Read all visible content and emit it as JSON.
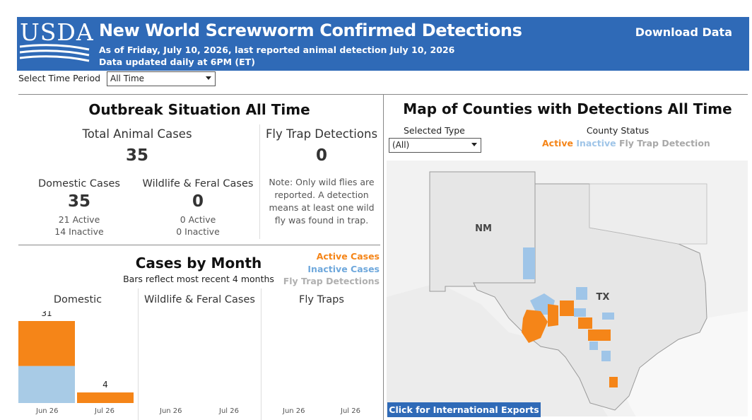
{
  "header": {
    "logo_text": "USDA",
    "title": "New World Screwworm Confirmed Detections",
    "subtitle1": "As of Friday, July 10, 2026, last reported animal detection July 10, 2026",
    "subtitle2": "Data updated daily at 6PM (ET)",
    "download": "Download Data",
    "bg_color": "#2f6ab7"
  },
  "filters": {
    "time_period_label": "Select Time Period",
    "time_period_value": "All Time"
  },
  "outbreak": {
    "title": "Outbreak Situation All Time",
    "total_label": "Total Animal Cases",
    "total_value": "35",
    "domestic_label": "Domestic Cases",
    "domestic_value": "35",
    "domestic_active": "21 Active",
    "domestic_inactive": "14 Inactive",
    "wildlife_label": "Wildlife & Feral Cases",
    "wildlife_value": "0",
    "wildlife_active": "0 Active",
    "wildlife_inactive": "0 Inactive",
    "flytrap_label": "Fly Trap Detections",
    "flytrap_value": "0",
    "flytrap_note": "Note: Only wild flies are reported. A detection means at least one wild fly was found in trap."
  },
  "cases_by_month": {
    "title": "Cases by Month",
    "subtitle": "Bars reflect most recent 4 months",
    "legend": [
      {
        "label": "Active Cases",
        "color": "#f58518"
      },
      {
        "label": "Inactive Cases",
        "color": "#6fa8dc"
      },
      {
        "label": "Fly Trap Detections",
        "color": "#b0b0b0"
      }
    ],
    "panels": {
      "domestic": "Domestic",
      "wildlife": "Wildlife & Feral Cases",
      "flytraps": "Fly Traps"
    }
  },
  "chart_data": {
    "type": "bar",
    "categories": [
      "Jun 26",
      "Jul 26"
    ],
    "series": [
      {
        "name": "Active Cases",
        "panel": "Domestic",
        "values": [
          17,
          4
        ],
        "color": "#f58518"
      },
      {
        "name": "Inactive Cases",
        "panel": "Domestic",
        "values": [
          14,
          0
        ],
        "color": "#a8cbe6"
      }
    ],
    "totals": [
      "31",
      "4"
    ],
    "ylim": [
      0,
      31
    ],
    "panels": [
      "Domestic",
      "Wildlife & Feral Cases",
      "Fly Traps"
    ]
  },
  "map": {
    "title": "Map of Counties with Detections All Time",
    "selected_type_label": "Selected Type",
    "selected_type_value": "(All)",
    "county_status_label": "County Status",
    "status_active": "Active",
    "status_inactive": "Inactive",
    "status_flytrap": "Fly Trap Detection",
    "state_nm": "NM",
    "state_tx": "TX",
    "export_button": "Click for International Exports"
  }
}
